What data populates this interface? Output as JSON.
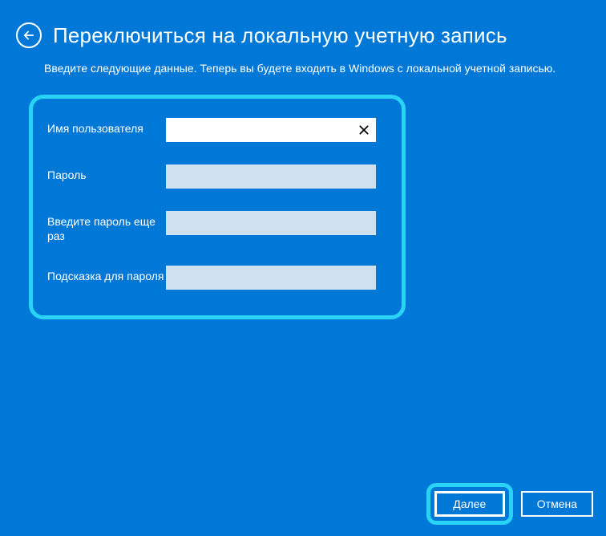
{
  "header": {
    "title": "Переключиться на локальную учетную запись"
  },
  "description": "Введите следующие данные. Теперь вы будете входить в Windows с локальной учетной записью.",
  "form": {
    "username": {
      "label": "Имя пользователя",
      "value": ""
    },
    "password": {
      "label": "Пароль",
      "value": ""
    },
    "password_confirm": {
      "label": "Введите пароль еще раз",
      "value": ""
    },
    "hint": {
      "label": "Подсказка для пароля",
      "value": ""
    }
  },
  "footer": {
    "next_label": "Далее",
    "cancel_label": "Отмена"
  }
}
